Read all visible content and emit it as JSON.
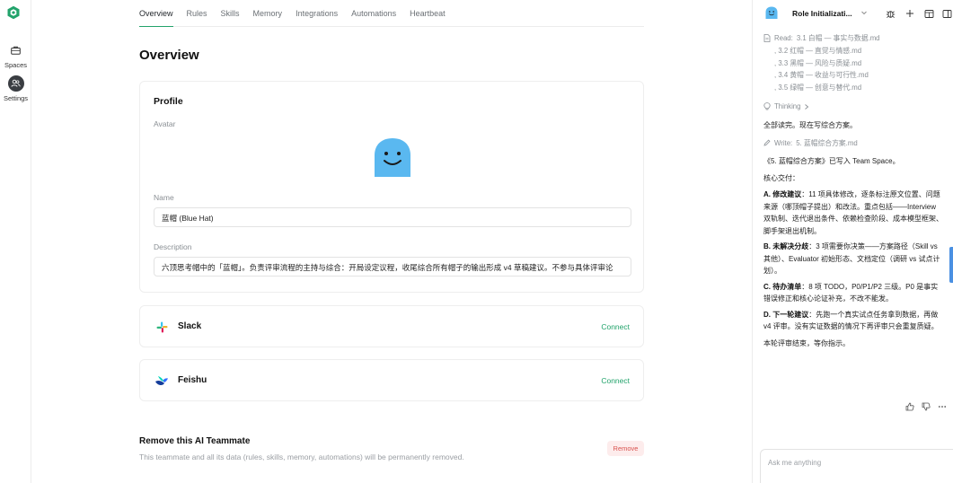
{
  "rail": {
    "items": [
      {
        "label": "Spaces"
      },
      {
        "label": "Settings"
      }
    ]
  },
  "tabs": [
    "Overview",
    "Rules",
    "Skills",
    "Memory",
    "Integrations",
    "Automations",
    "Heartbeat"
  ],
  "page": {
    "title": "Overview"
  },
  "profile": {
    "title": "Profile",
    "avatar_label": "Avatar",
    "name_label": "Name",
    "name_value": "蓝帽 (Blue Hat)",
    "description_label": "Description",
    "description_value": "六顶思考帽中的「蓝帽」。负责评审流程的主持与综合：开局设定议程，收尾综合所有帽子的输出形成 v4 草稿建议。不参与具体评审论"
  },
  "integrations": [
    {
      "name": "Slack",
      "action": "Connect"
    },
    {
      "name": "Feishu",
      "action": "Connect"
    }
  ],
  "danger": {
    "title": "Remove this AI Teammate",
    "description": "This teammate and all its data (rules, skills, memory, automations) will be permanently removed.",
    "button": "Remove"
  },
  "panel": {
    "title": "Role Initializati...",
    "read_prefix": "Read:",
    "read_files": [
      "3.1 白帽 — 事实与数据.md",
      ", 3.2 红帽 — 直觉与情感.md",
      ", 3.3 黑帽 — 风险与质疑.md",
      ", 3.4 黄帽 — 收益与可行性.md",
      ", 3.5 绿帽 — 创意与替代.md"
    ],
    "thinking": "Thinking",
    "msg1": "全部读完。现在写综合方案。",
    "write_prefix": "Write:",
    "write_file": "5. 蓝帽综合方案.md",
    "msg2": "《5. 蓝帽综合方案》已写入 Team Space。",
    "msg3": "核心交付：",
    "a_title": "A. 修改建议",
    "a_body": "：11 项具体修改，逐条标注原文位置、问题来源（哪顶帽子提出）和改法。重点包括——Interview 双轨制、迭代退出条件、依赖检查阶段、成本模型框架、脚手架退出机制。",
    "b_title": "B. 未解决分歧",
    "b_body": "：3 项需要你决策——方案路径（Skill vs 其他）、Evaluator 初始形态、文档定位（调研 vs 试点计划）。",
    "c_title": "C. 待办清单",
    "c_body": "：8 项 TODO，P0/P1/P2 三级。P0 是事实错误修正和核心论证补充，不改不能发。",
    "d_title": "D. 下一轮建议",
    "d_body": "：先跑一个真实试点任务拿到数据，再做 v4 评审。没有实证数据的情况下再评审只会重复质疑。",
    "msg4": "本轮评审结束，等你指示。",
    "composer_placeholder": "Ask me anything"
  },
  "colors": {
    "accent": "#22a36b",
    "danger": "#d9534f",
    "avatar": "#5ab8f0"
  }
}
